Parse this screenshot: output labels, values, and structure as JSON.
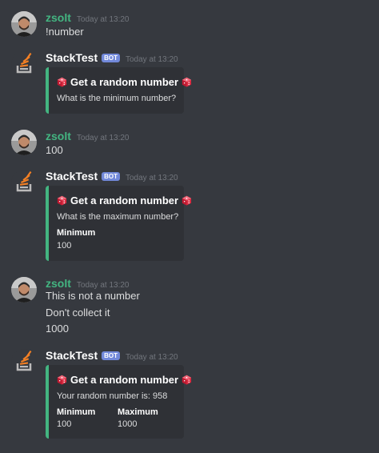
{
  "colors": {
    "background": "#36393f",
    "embed_bg": "#2f3136",
    "embed_accent": "#43b581",
    "user_name": "#43b581",
    "bot_tag": "#7289da",
    "timestamp": "#72767d"
  },
  "messages": [
    {
      "author": "zsolt",
      "timestamp": "Today at 13:20",
      "lines": [
        "!number"
      ]
    },
    {
      "author": "StackTest",
      "tag": "BOT",
      "timestamp": "Today at 13:20",
      "embed": {
        "title": "Get a random number",
        "description": "What is the minimum number?"
      }
    },
    {
      "author": "zsolt",
      "timestamp": "Today at 13:20",
      "lines": [
        "100"
      ]
    },
    {
      "author": "StackTest",
      "tag": "BOT",
      "timestamp": "Today at 13:20",
      "embed": {
        "title": "Get a random number",
        "description": "What is the maximum number?",
        "fields": [
          {
            "name": "Minimum",
            "value": "100"
          }
        ]
      }
    },
    {
      "author": "zsolt",
      "timestamp": "Today at 13:20",
      "lines": [
        "This is not a number",
        "Don't collect it",
        "1000"
      ]
    },
    {
      "author": "StackTest",
      "tag": "BOT",
      "timestamp": "Today at 13:20",
      "embed": {
        "title": "Get a random number",
        "description": "Your random number is: 958",
        "fields": [
          {
            "name": "Minimum",
            "value": "100"
          },
          {
            "name": "Maximum",
            "value": "1000"
          }
        ]
      }
    }
  ]
}
